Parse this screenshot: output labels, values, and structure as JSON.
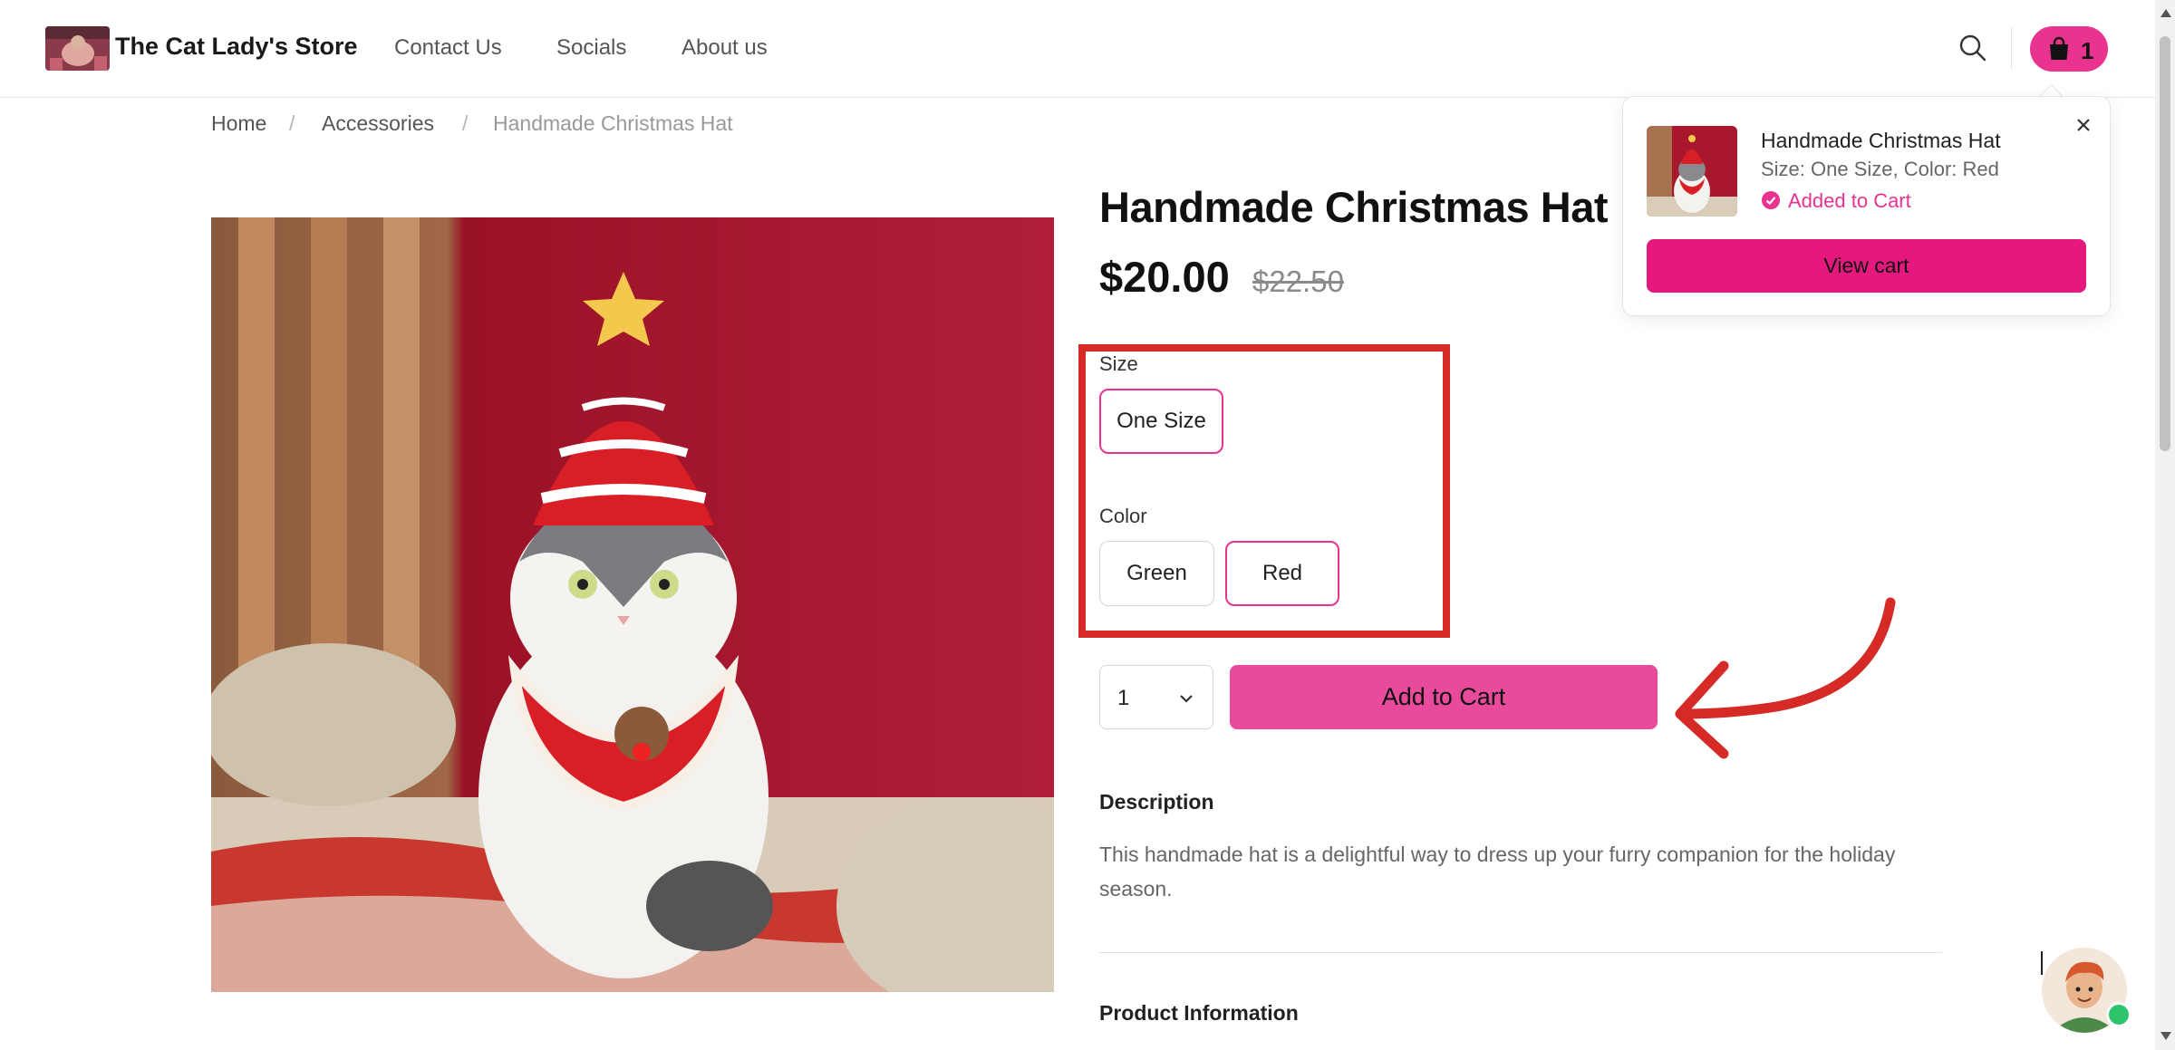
{
  "header": {
    "store_name": "The Cat Lady's Store",
    "nav": [
      "Contact Us",
      "Socials",
      "About us"
    ],
    "cart_count": "1"
  },
  "breadcrumb": {
    "items": [
      "Home",
      "Accessories",
      "Handmade Christmas Hat"
    ],
    "separator": "/"
  },
  "product": {
    "title": "Handmade Christmas Hat",
    "price": "$20.00",
    "compare_price": "$22.50",
    "size_label": "Size",
    "sizes": [
      "One Size"
    ],
    "selected_size": "One Size",
    "color_label": "Color",
    "colors": [
      "Green",
      "Red"
    ],
    "selected_color": "Red",
    "quantity": "1",
    "add_to_cart": "Add to Cart",
    "description_heading": "Description",
    "description": "This handmade hat is a delightful way to dress up your furry companion for the holiday season.",
    "info_heading": "Product Information"
  },
  "cart_popup": {
    "title": "Handmade Christmas Hat",
    "variant": "Size: One Size, Color: Red",
    "status": "Added to Cart",
    "view_cart": "View cart"
  },
  "icons": {
    "search": "search-icon",
    "cart": "shopping-bag-icon",
    "close": "close-icon",
    "chevron": "chevron-down-icon",
    "check": "check-circle-icon"
  },
  "colors": {
    "accent": "#e9338e",
    "annotation_red": "#d62a27"
  }
}
